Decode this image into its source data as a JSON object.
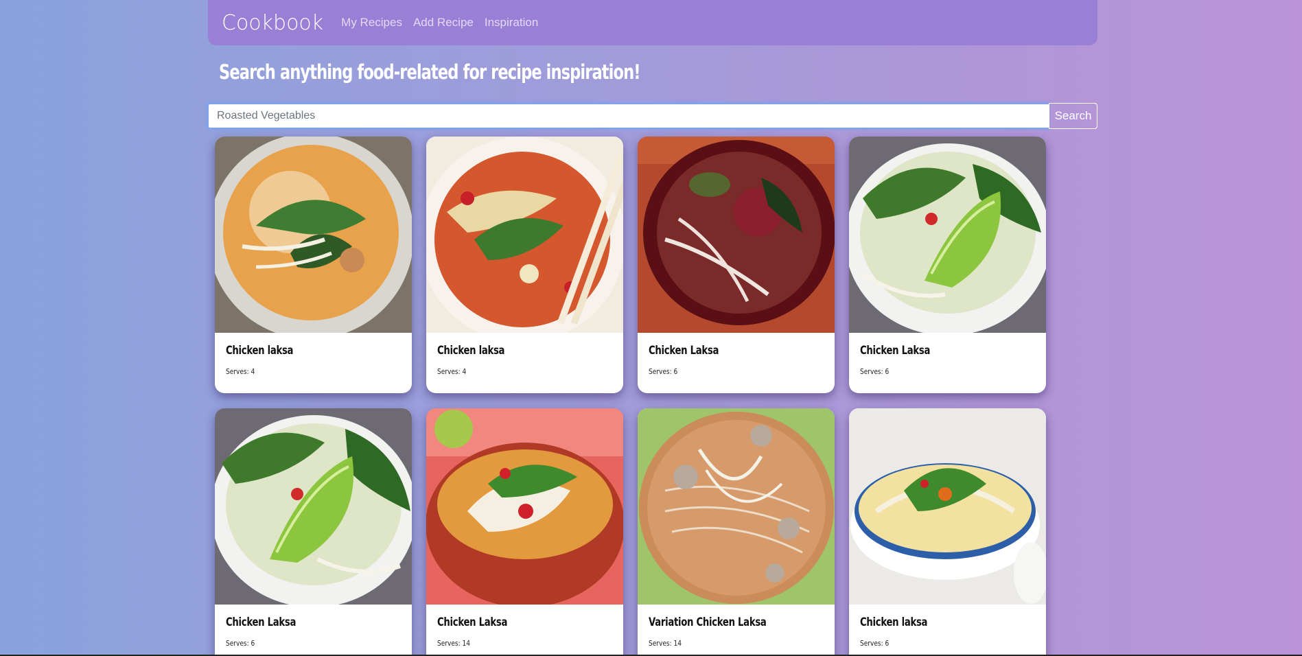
{
  "navbar": {
    "brand": "Cookbook",
    "links": [
      "My Recipes",
      "Add Recipe",
      "Inspiration"
    ]
  },
  "headline": "Search anything food-related for recipe inspiration!",
  "search": {
    "placeholder": "Roasted Vegetables",
    "value": "",
    "button_label": "Search"
  },
  "recipes": [
    {
      "title": "Chicken laksa",
      "serves": "Serves: 4",
      "image": "laksa-bowl-photo"
    },
    {
      "title": "Chicken laksa",
      "serves": "Serves: 4",
      "image": "laksa-chopsticks-photo"
    },
    {
      "title": "Chicken Laksa",
      "serves": "Serves: 6",
      "image": "laksa-red-bowl-photo"
    },
    {
      "title": "Chicken Laksa",
      "serves": "Serves: 6",
      "image": "laksa-lime-photo"
    },
    {
      "title": "Chicken Laksa",
      "serves": "Serves: 6",
      "image": "laksa-lime-photo"
    },
    {
      "title": "Chicken Laksa",
      "serves": "Serves: 14",
      "image": "laksa-red-bowl-photo"
    },
    {
      "title": "Variation Chicken Laksa",
      "serves": "Serves: 14",
      "image": "laksa-noodles-photo"
    },
    {
      "title": "Chicken laksa",
      "serves": "Serves: 6",
      "image": "laksa-white-bowl-photo"
    }
  ],
  "colors": {
    "navbar": "#9a7fd6",
    "gradient_left": "#8aa3dd",
    "gradient_right": "#bb92d7",
    "search_focus": "#7ea2ea"
  }
}
